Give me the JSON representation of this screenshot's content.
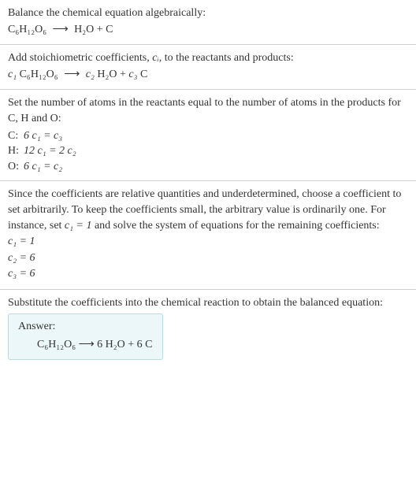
{
  "s1": {
    "intro": "Balance the chemical equation algebraically:",
    "lhs": "C₆H₁₂O₆",
    "arrow": "⟶",
    "rhs": "H₂O + C"
  },
  "s2": {
    "intro_a": "Add stoichiometric coefficients, ",
    "intro_ci": "cᵢ",
    "intro_b": ", to the reactants and products:",
    "c1": "c₁",
    "f1": " C₆H₁₂O₆",
    "arrow": "⟶",
    "c2": "c₂",
    "f2": " H₂O + ",
    "c3": "c₃",
    "f3": " C"
  },
  "s3": {
    "intro": "Set the number of atoms in the reactants equal to the number of atoms in the products for C, H and O:",
    "rows": [
      {
        "el": "C:",
        "eq_l": "6 c₁ = c₃"
      },
      {
        "el": "H:",
        "eq_l": "12 c₁ = 2 c₂"
      },
      {
        "el": "O:",
        "eq_l": "6 c₁ = c₂"
      }
    ]
  },
  "s4": {
    "intro_a": "Since the coefficients are relative quantities and underdetermined, choose a coefficient to set arbitrarily. To keep the coefficients small, the arbitrary value is ordinarily one. For instance, set ",
    "intro_set": "c₁ = 1",
    "intro_b": " and solve the system of equations for the remaining coefficients:",
    "sol": [
      "c₁ = 1",
      "c₂ = 6",
      "c₃ = 6"
    ]
  },
  "s5": {
    "intro": "Substitute the coefficients into the chemical reaction to obtain the balanced equation:",
    "answer_label": "Answer:",
    "eq": "C₆H₁₂O₆  ⟶  6 H₂O + 6 C"
  },
  "chart_data": {
    "type": "table",
    "title": "Balancing C6H12O6 → H2O + C",
    "unbalanced": {
      "reactants": [
        "C6H12O6"
      ],
      "products": [
        "H2O",
        "C"
      ]
    },
    "atom_equations": [
      {
        "element": "C",
        "equation": "6 c1 = c3"
      },
      {
        "element": "H",
        "equation": "12 c1 = 2 c2"
      },
      {
        "element": "O",
        "equation": "6 c1 = c2"
      }
    ],
    "solution": {
      "c1": 1,
      "c2": 6,
      "c3": 6
    },
    "balanced": "C6H12O6 → 6 H2O + 6 C"
  }
}
